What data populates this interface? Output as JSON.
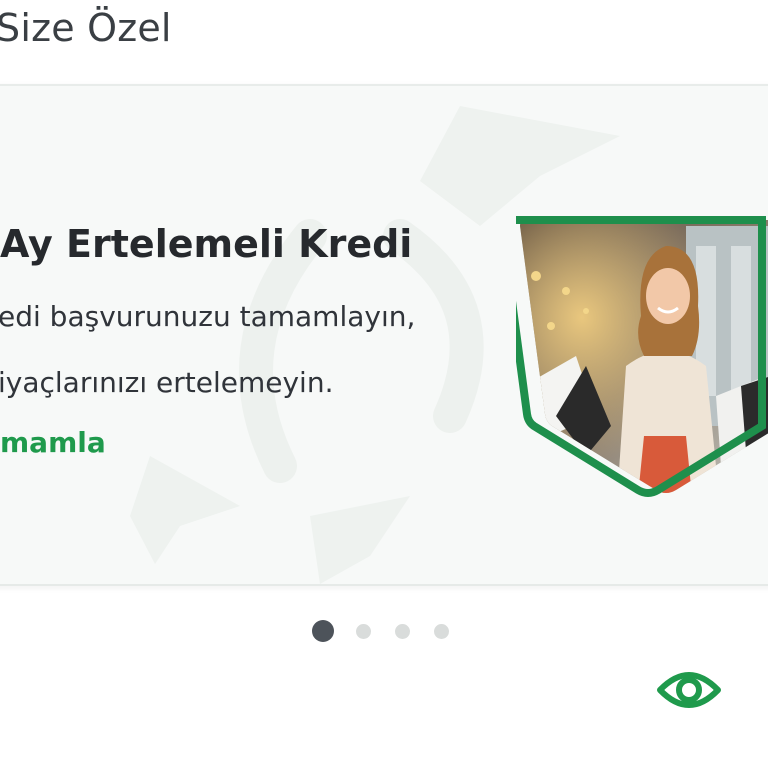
{
  "section": {
    "title": "Size Özel"
  },
  "banner": {
    "title": "Ay Ertelemeli Kredi",
    "line1": "edi başvurunuzu tamamlayın,",
    "line2": "iyaçlarınızı ertelemeyin.",
    "cta": "mamla"
  },
  "carousel": {
    "slides": 4,
    "active_index": 0
  },
  "colors": {
    "accent": "#1f9a4c",
    "frame": "#1e8f4c",
    "dot_active": "#4d535a",
    "dot_inactive": "#d9dcdb"
  },
  "icons": {
    "visibility": "eye-icon"
  }
}
